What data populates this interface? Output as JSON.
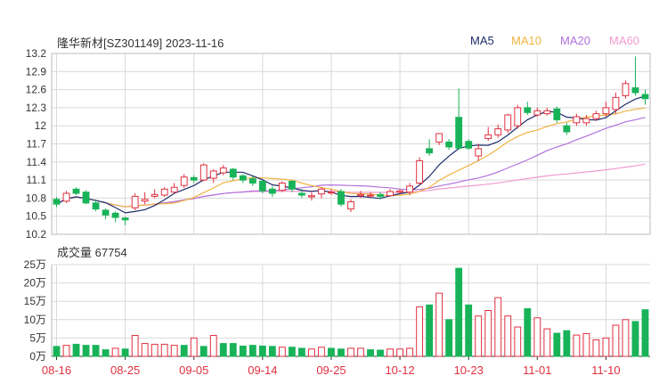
{
  "header": {
    "title": "隆华新材[SZ301149] 2023-11-16",
    "legend": [
      {
        "label": "MA5",
        "color": "#1f2d6b"
      },
      {
        "label": "MA10",
        "color": "#f0b443"
      },
      {
        "label": "MA20",
        "color": "#b071dd"
      },
      {
        "label": "MA60",
        "color": "#f29bd0"
      }
    ]
  },
  "volume_title": "成交量 67754",
  "colors": {
    "up": "#e03040",
    "down": "#18b358",
    "grid": "#d9d9d9",
    "axis": "#333333"
  },
  "chart_data": [
    {
      "type": "candlestick",
      "ylim": [
        10.2,
        13.2
      ],
      "yticks": [
        "13.2",
        "12.9",
        "12.6",
        "12.3",
        "12",
        "11.7",
        "11.4",
        "11.1",
        "10.8",
        "10.5",
        "10.2"
      ],
      "xticks": [
        {
          "index": 0,
          "label": "08-16"
        },
        {
          "index": 7,
          "label": "08-25"
        },
        {
          "index": 14,
          "label": "09-05"
        },
        {
          "index": 21,
          "label": "09-14"
        },
        {
          "index": 28,
          "label": "09-25"
        },
        {
          "index": 35,
          "label": "10-12"
        },
        {
          "index": 42,
          "label": "10-23"
        },
        {
          "index": 49,
          "label": "11-01"
        },
        {
          "index": 56,
          "label": "11-10"
        }
      ],
      "candles": [
        [
          10.78,
          10.7,
          10.82,
          10.65
        ],
        [
          10.75,
          10.88,
          10.92,
          10.72
        ],
        [
          10.95,
          10.88,
          10.98,
          10.85
        ],
        [
          10.9,
          10.72,
          10.93,
          10.7
        ],
        [
          10.72,
          10.62,
          10.78,
          10.58
        ],
        [
          10.6,
          10.52,
          10.63,
          10.45
        ],
        [
          10.55,
          10.48,
          10.58,
          10.4
        ],
        [
          10.47,
          10.44,
          10.49,
          10.35
        ],
        [
          10.64,
          10.83,
          10.88,
          10.6
        ],
        [
          10.75,
          10.78,
          10.9,
          10.7
        ],
        [
          10.83,
          10.86,
          10.95,
          10.8
        ],
        [
          10.85,
          10.95,
          10.98,
          10.82
        ],
        [
          10.9,
          10.98,
          11.05,
          10.88
        ],
        [
          11.01,
          11.15,
          11.2,
          10.97
        ],
        [
          11.14,
          11.1,
          11.18,
          11.05
        ],
        [
          11.1,
          11.35,
          11.38,
          11.08
        ],
        [
          11.13,
          11.25,
          11.28,
          11.05
        ],
        [
          11.22,
          11.3,
          11.35,
          11.18
        ],
        [
          11.28,
          11.15,
          11.3,
          11.1
        ],
        [
          11.17,
          11.1,
          11.2,
          11.05
        ],
        [
          11.12,
          11.05,
          11.16,
          11.0
        ],
        [
          11.08,
          10.92,
          11.1,
          10.88
        ],
        [
          10.95,
          10.88,
          11.0,
          10.82
        ],
        [
          10.93,
          11.05,
          11.08,
          10.9
        ],
        [
          11.08,
          10.95,
          11.1,
          10.9
        ],
        [
          10.88,
          10.85,
          10.95,
          10.8
        ],
        [
          10.82,
          10.84,
          10.9,
          10.76
        ],
        [
          10.87,
          10.95,
          10.98,
          10.8
        ],
        [
          10.9,
          10.9,
          10.95,
          10.85
        ],
        [
          10.91,
          10.7,
          10.95,
          10.66
        ],
        [
          10.62,
          10.74,
          10.78,
          10.57
        ],
        [
          10.84,
          10.86,
          10.92,
          10.8
        ],
        [
          10.85,
          10.85,
          10.9,
          10.8
        ],
        [
          10.86,
          10.83,
          10.9,
          10.78
        ],
        [
          10.84,
          10.91,
          10.95,
          10.82
        ],
        [
          10.9,
          10.92,
          10.95,
          10.88
        ],
        [
          10.9,
          11.0,
          11.05,
          10.85
        ],
        [
          11.05,
          11.42,
          11.48,
          11.02
        ],
        [
          11.62,
          11.55,
          11.78,
          11.5
        ],
        [
          11.73,
          11.87,
          11.88,
          11.68
        ],
        [
          11.73,
          11.65,
          11.78,
          11.6
        ],
        [
          12.14,
          11.63,
          12.62,
          11.6
        ],
        [
          11.74,
          11.63,
          11.78,
          11.6
        ],
        [
          11.5,
          11.62,
          11.7,
          11.42
        ],
        [
          11.79,
          11.85,
          11.98,
          11.75
        ],
        [
          11.85,
          11.95,
          12.02,
          11.8
        ],
        [
          11.93,
          12.18,
          12.2,
          11.88
        ],
        [
          12.0,
          12.3,
          12.35,
          11.95
        ],
        [
          12.3,
          12.22,
          12.4,
          12.18
        ],
        [
          12.18,
          12.25,
          12.3,
          12.15
        ],
        [
          12.2,
          12.25,
          12.3,
          12.17
        ],
        [
          12.28,
          12.1,
          12.32,
          12.05
        ],
        [
          12.0,
          11.9,
          12.05,
          11.85
        ],
        [
          12.05,
          12.15,
          12.2,
          12.0
        ],
        [
          12.05,
          12.12,
          12.18,
          12.0
        ],
        [
          12.12,
          12.2,
          12.25,
          12.08
        ],
        [
          12.2,
          12.3,
          12.4,
          12.15
        ],
        [
          12.27,
          12.47,
          12.55,
          12.2
        ],
        [
          12.5,
          12.7,
          12.75,
          12.45
        ],
        [
          12.63,
          12.55,
          13.15,
          12.5
        ],
        [
          12.52,
          12.45,
          12.6,
          12.35
        ]
      ]
    },
    {
      "type": "bar",
      "title": "成交量 67754",
      "ylim": [
        0,
        250000
      ],
      "yticks": [
        "25万",
        "20万",
        "15万",
        "10万",
        "5万",
        "0万"
      ],
      "values": [
        27000,
        30000,
        33000,
        30000,
        30000,
        18000,
        22000,
        20000,
        57000,
        35000,
        33000,
        33000,
        30000,
        30000,
        50000,
        27000,
        57000,
        35000,
        35000,
        28000,
        30000,
        28000,
        27000,
        25000,
        25000,
        22000,
        20000,
        25000,
        22000,
        20000,
        22000,
        22000,
        18000,
        17000,
        20000,
        20000,
        22000,
        135000,
        140000,
        172000,
        100000,
        240000,
        140000,
        110000,
        125000,
        160000,
        110000,
        80000,
        130000,
        105000,
        75000,
        63000,
        70000,
        58000,
        62000,
        45000,
        50000,
        85000,
        100000,
        95000,
        127000,
        68000
      ],
      "direction": [
        "down",
        "up",
        "down",
        "down",
        "down",
        "down",
        "up",
        "down",
        "up",
        "up",
        "up",
        "up",
        "up",
        "down",
        "up",
        "down",
        "up",
        "down",
        "down",
        "down",
        "down",
        "down",
        "down",
        "up",
        "down",
        "down",
        "up",
        "up",
        "down",
        "down",
        "up",
        "up",
        "down",
        "down",
        "up",
        "up",
        "up",
        "up",
        "down",
        "up",
        "down",
        "down",
        "down",
        "up",
        "up",
        "up",
        "up",
        "up",
        "down",
        "up",
        "up",
        "down",
        "down",
        "up",
        "up",
        "up",
        "up",
        "up",
        "up",
        "down",
        "down",
        "down"
      ]
    }
  ]
}
